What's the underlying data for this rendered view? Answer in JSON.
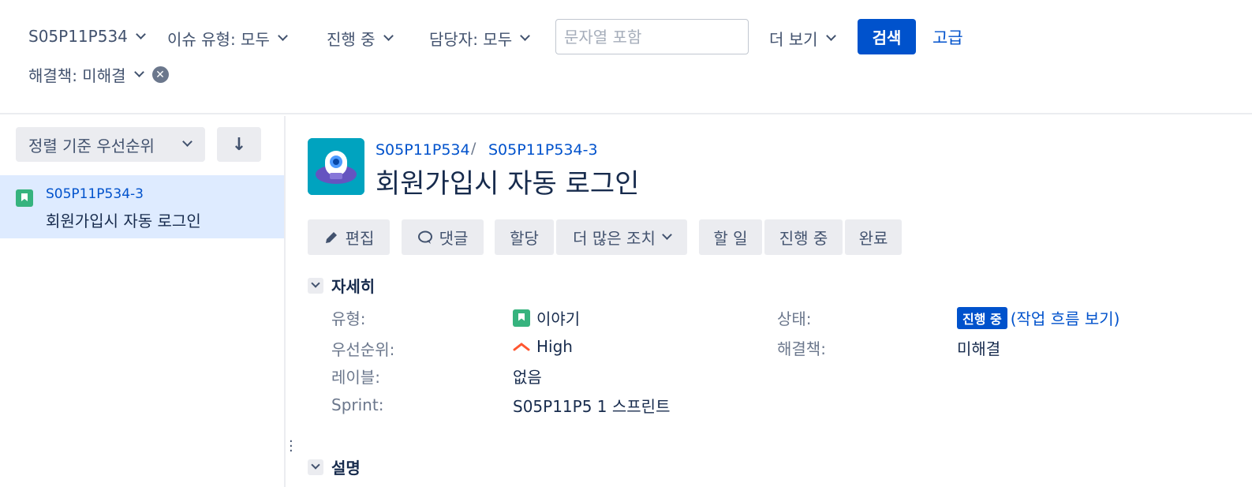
{
  "filters": {
    "project": "S05P11P534",
    "issue_type": "이슈 유형: 모두",
    "status": "진행 중",
    "assignee": "담당자: 모두",
    "text_search_placeholder": "문자열 포함",
    "more": "더 보기",
    "search_button": "검색",
    "advanced_link": "고급",
    "resolution": "해결책: 미해결"
  },
  "list": {
    "sort_label": "정렬 기준 우선순위",
    "sort_direction_icon": "arrow-down-icon",
    "items": [
      {
        "key": "S05P11P534-3",
        "summary": "회원가입시 자동 로그인",
        "type_icon": "story-icon"
      }
    ]
  },
  "issue": {
    "breadcrumb_project": "S05P11P534",
    "breadcrumb_sep": "/",
    "breadcrumb_key": "S05P11P534-3",
    "title": "회원가입시 자동 로그인",
    "actions": {
      "edit": "편집",
      "comment": "댓글",
      "assign": "할당",
      "more_actions": "더 많은 조치",
      "todo": "할 일",
      "in_progress": "진행 중",
      "done": "완료"
    },
    "details_heading": "자세히",
    "fields": {
      "type_label": "유형:",
      "type_value": "이야기",
      "priority_label": "우선순위:",
      "priority_value": "High",
      "labels_label": "레이블:",
      "labels_value": "없음",
      "sprint_label": "Sprint:",
      "sprint_value": "S05P11P5 1 스프린트",
      "status_label": "상태:",
      "status_value": "진행 중",
      "workflow_link": "(작업 흐름 보기)",
      "resolution_label": "해결책:",
      "resolution_value": "미해결"
    },
    "description_heading": "설명"
  },
  "colors": {
    "primary": "#0052cc",
    "story_green": "#36b37e",
    "priority_high": "#ff5630",
    "selected_bg": "#deebff"
  }
}
